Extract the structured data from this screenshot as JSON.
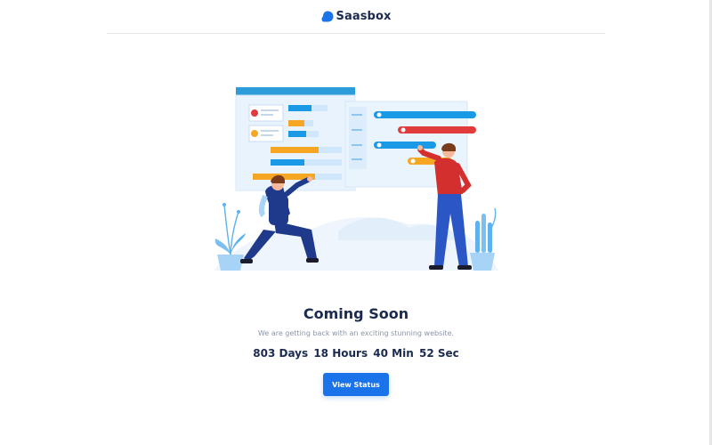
{
  "brand": {
    "name": "Saasbox",
    "logo_icon": "cloud-blob-icon",
    "accent_color": "#1a73e8"
  },
  "hero": {
    "illustration": "team-planning-illustration"
  },
  "main": {
    "title": "Coming Soon",
    "subtitle": "We are getting back with an exciting stunning website.",
    "countdown": {
      "days": "803 Days",
      "hours": "18 Hours",
      "minutes": "40 Min",
      "seconds": "52 Sec"
    },
    "cta_label": "View Status"
  }
}
